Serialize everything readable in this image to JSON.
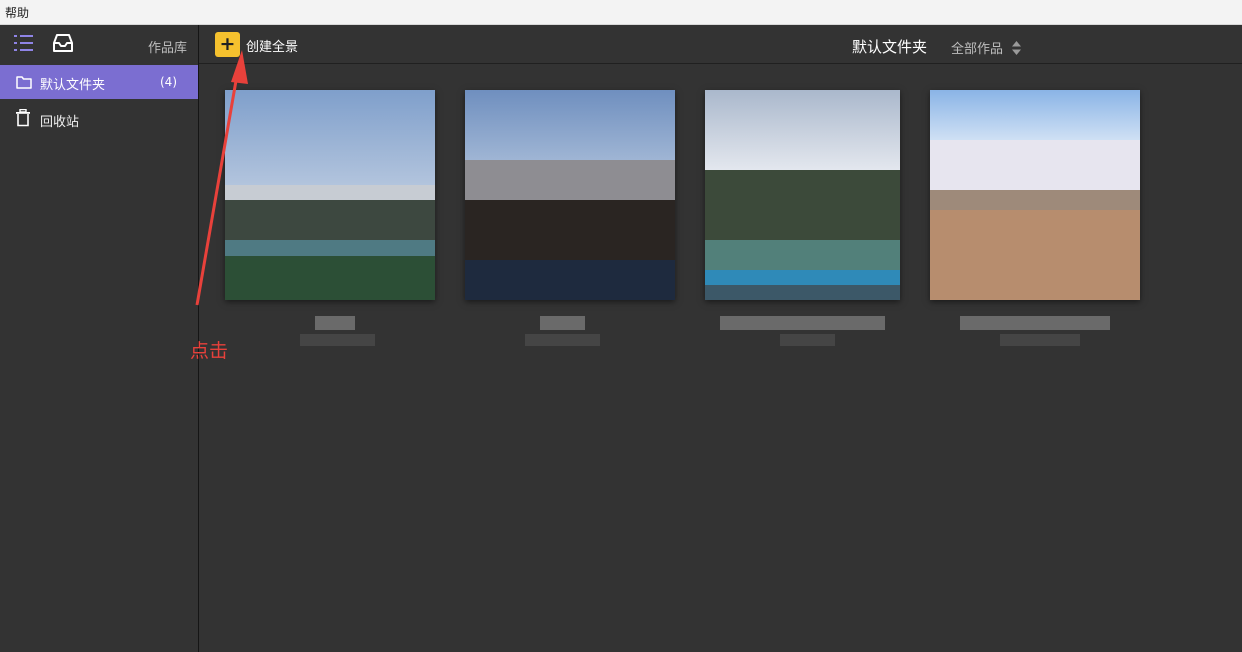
{
  "menubar": {
    "help": "帮助"
  },
  "sidebar": {
    "library_label": "作品库",
    "items": [
      {
        "label": "默认文件夹",
        "count": "(4)",
        "icon": "folder-icon",
        "selected": true
      },
      {
        "label": "回收站",
        "icon": "trash-icon",
        "selected": false
      }
    ]
  },
  "toolbar": {
    "create_label": "创建全景",
    "folder_title": "默认文件夹",
    "filter_label": "全部作品"
  },
  "annotation": {
    "text": "点击",
    "color": "#e8413b"
  },
  "colors": {
    "accent": "#7b6ed1",
    "create_button": "#f5c12e",
    "background": "#333333"
  }
}
